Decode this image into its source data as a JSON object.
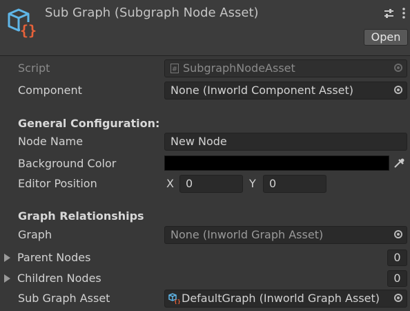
{
  "header": {
    "title": "Sub Graph (Subgraph Node Asset)",
    "open_label": "Open",
    "icon": "subgraph-asset-icon",
    "accent_color": "#5fb6e8",
    "brace_color": "#e8623a"
  },
  "fields": {
    "script": {
      "label": "Script",
      "value": "SubgraphNodeAsset"
    },
    "component": {
      "label": "Component",
      "value": "None (Inworld Component Asset)"
    }
  },
  "general": {
    "heading": "General Configuration:",
    "node_name": {
      "label": "Node Name",
      "value": "New Node"
    },
    "background_color": {
      "label": "Background Color",
      "value": "#000000"
    },
    "editor_position": {
      "label": "Editor Position",
      "x_label": "X",
      "x": "0",
      "y_label": "Y",
      "y": "0"
    }
  },
  "relationships": {
    "heading": "Graph Relationships",
    "graph": {
      "label": "Graph",
      "value": "None (Inworld Graph Asset)"
    },
    "parent_nodes": {
      "label": "Parent Nodes",
      "count": "0"
    },
    "children_nodes": {
      "label": "Children Nodes",
      "count": "0"
    },
    "sub_graph_asset": {
      "label": "Sub Graph Asset",
      "value": "DefaultGraph (Inworld Graph Asset)"
    }
  }
}
